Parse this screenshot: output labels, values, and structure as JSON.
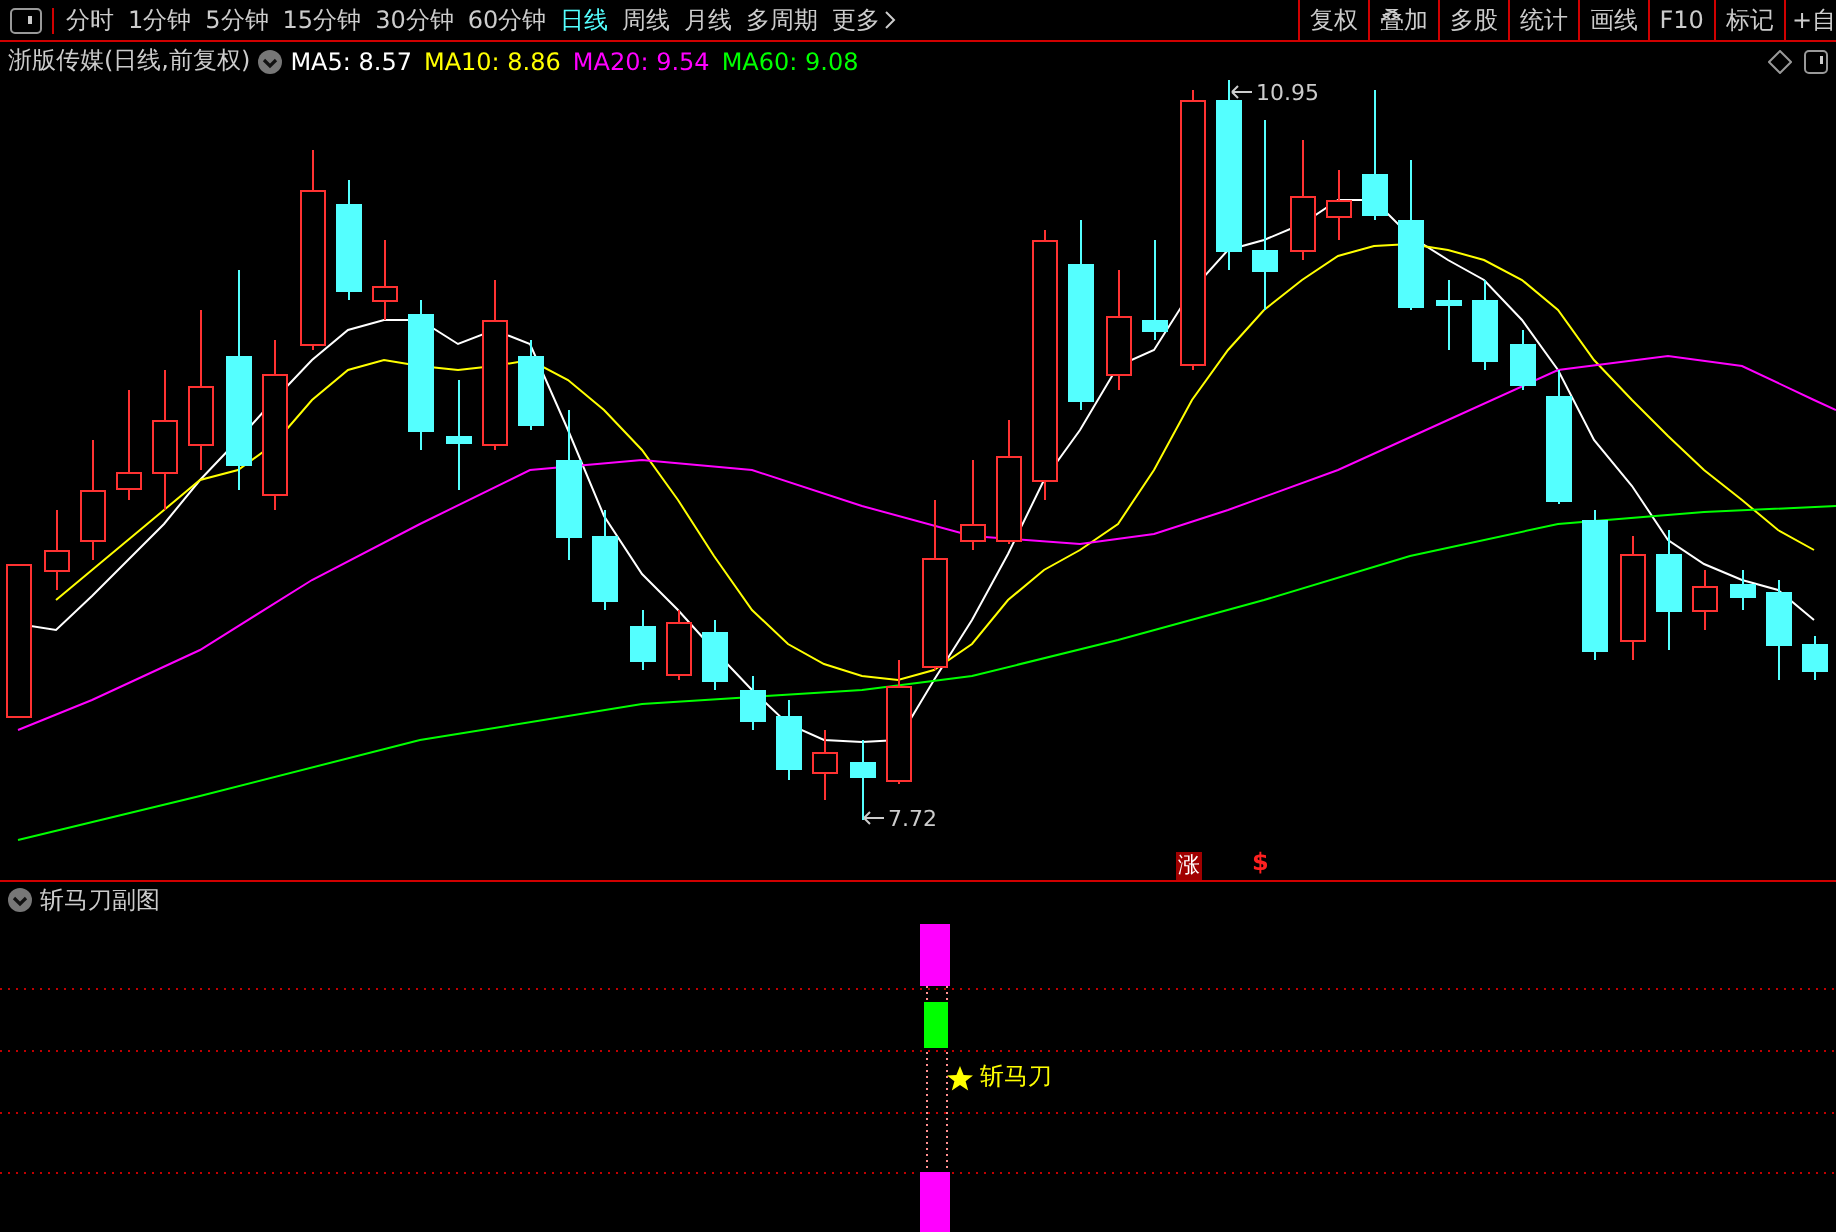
{
  "toolbar": {
    "periods": [
      {
        "label": "分时",
        "selected": false
      },
      {
        "label": "1分钟",
        "selected": false
      },
      {
        "label": "5分钟",
        "selected": false
      },
      {
        "label": "15分钟",
        "selected": false
      },
      {
        "label": "30分钟",
        "selected": false
      },
      {
        "label": "60分钟",
        "selected": false
      },
      {
        "label": "日线",
        "selected": true
      },
      {
        "label": "周线",
        "selected": false
      },
      {
        "label": "月线",
        "selected": false
      },
      {
        "label": "多周期",
        "selected": false
      },
      {
        "label": "更多",
        "selected": false
      }
    ],
    "actions": [
      "复权",
      "叠加",
      "多股",
      "统计",
      "画线",
      "F10",
      "标记",
      "+自"
    ]
  },
  "legend": {
    "title": "浙版传媒(日线,前复权)",
    "ma": [
      {
        "label": "MA5: 8.57",
        "color": "#ffffff"
      },
      {
        "label": "MA10: 8.86",
        "color": "#ffff00"
      },
      {
        "label": "MA20: 9.54",
        "color": "#ff00ff"
      },
      {
        "label": "MA60: 9.08",
        "color": "#00ff00"
      }
    ]
  },
  "main_chart": {
    "high_label": "10.95",
    "low_label": "7.72",
    "markers": [
      {
        "kind": "rise",
        "text": "涨"
      },
      {
        "kind": "dollar",
        "text": "$"
      }
    ]
  },
  "sub_chart": {
    "title": "斩马刀副图",
    "signal": "斩马刀"
  }
}
